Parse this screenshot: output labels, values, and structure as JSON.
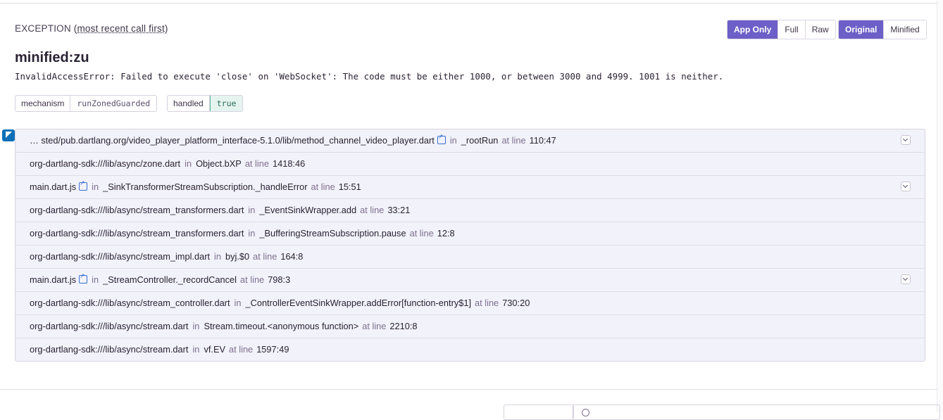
{
  "exception": {
    "header_label": "EXCEPTION",
    "header_sub": "most recent call first",
    "type": "minified:zu",
    "value": "InvalidAccessError: Failed to execute 'close' on 'WebSocket': The code must be either 1000, or between 3000 and 4999. 1001 is neither."
  },
  "view_buttons": [
    "App Only",
    "Full",
    "Raw"
  ],
  "symbol_buttons": [
    "Original",
    "Minified"
  ],
  "active": {
    "view": "App Only",
    "symbol": "Original"
  },
  "tags": {
    "mechanism": {
      "key": "mechanism",
      "value": "runZonedGuarded"
    },
    "handled": {
      "key": "handled",
      "value": "true"
    }
  },
  "platform_icon": "dart-icon",
  "connectors": {
    "in": "in",
    "at_line": "at line"
  },
  "frames": [
    {
      "file": "… sted/pub.dartlang.org/video_player_platform_interface-5.1.0/lib/method_channel_video_player.dart",
      "external_link": true,
      "function": "_rootRun",
      "line": "110:47",
      "expandable": true
    },
    {
      "file": "org-dartlang-sdk:///lib/async/zone.dart",
      "external_link": false,
      "function": "Object.bXP",
      "line": "1418:46",
      "expandable": false
    },
    {
      "file": "main.dart.js",
      "external_link": true,
      "function": "_SinkTransformerStreamSubscription._handleError",
      "line": "15:51",
      "expandable": true
    },
    {
      "file": "org-dartlang-sdk:///lib/async/stream_transformers.dart",
      "external_link": false,
      "function": "_EventSinkWrapper.add",
      "line": "33:21",
      "expandable": false
    },
    {
      "file": "org-dartlang-sdk:///lib/async/stream_transformers.dart",
      "external_link": false,
      "function": "_BufferingStreamSubscription.pause",
      "line": "12:8",
      "expandable": false
    },
    {
      "file": "org-dartlang-sdk:///lib/async/stream_impl.dart",
      "external_link": false,
      "function": "byj.$0",
      "line": "164:8",
      "expandable": false
    },
    {
      "file": "main.dart.js",
      "external_link": true,
      "function": "_StreamController._recordCancel",
      "line": "798:3",
      "expandable": true
    },
    {
      "file": "org-dartlang-sdk:///lib/async/stream_controller.dart",
      "external_link": false,
      "function": "_ControllerEventSinkWrapper.addError[function-entry$1]",
      "line": "730:20",
      "expandable": false
    },
    {
      "file": "org-dartlang-sdk:///lib/async/stream.dart",
      "external_link": false,
      "function": "Stream.timeout.<anonymous function>",
      "line": "2210:8",
      "expandable": false
    },
    {
      "file": "org-dartlang-sdk:///lib/async/stream.dart",
      "external_link": false,
      "function": "vf.EV",
      "line": "1597:49",
      "expandable": false
    }
  ]
}
